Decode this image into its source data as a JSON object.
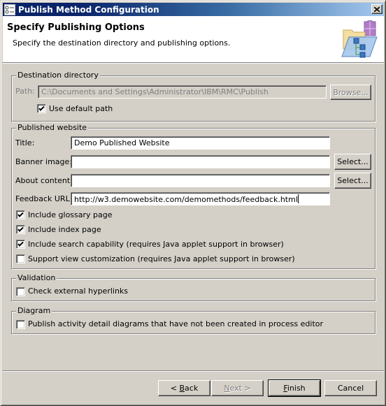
{
  "window": {
    "title": "Publish Method Configuration",
    "close_label": "×"
  },
  "header": {
    "title": "Specify Publishing Options",
    "description": "Specify the destination directory and publishing options."
  },
  "destination": {
    "legend": "Destination directory",
    "path_label": "Path:",
    "path_value": "C:\\Documents and Settings\\Administrator\\IBM\\RMC\\Publish",
    "browse_label": "Browse...",
    "use_default_label": "Use default path",
    "use_default_checked": true
  },
  "website": {
    "legend": "Published website",
    "title_label": "Title:",
    "title_value": "Demo Published Website",
    "banner_label": "Banner image:",
    "banner_value": "",
    "about_label": "About content:",
    "about_value": "",
    "select_label": "Select...",
    "feedback_label": "Feedback URL:",
    "feedback_value": "http://w3.demowebsite.com/demomethods/feedback.html",
    "options": [
      {
        "label": "Include glossary page",
        "checked": true
      },
      {
        "label": "Include index page",
        "checked": true
      },
      {
        "label": "Include search capability (requires Java applet support in browser)",
        "checked": true
      },
      {
        "label": "Support view customization (requires Java applet support in browser)",
        "checked": false
      }
    ]
  },
  "validation": {
    "legend": "Validation",
    "check_links_label": "Check external hyperlinks",
    "check_links_checked": false
  },
  "diagram": {
    "legend": "Diagram",
    "publish_diagrams_label": "Publish activity detail diagrams that have not been created in process editor",
    "publish_diagrams_checked": false
  },
  "buttons": {
    "back_prefix": "< ",
    "back_mnemonic": "B",
    "back_rest": "ack",
    "next_mnemonic": "N",
    "next_rest": "ext >",
    "finish_mnemonic": "F",
    "finish_rest": "inish",
    "cancel": "Cancel"
  }
}
